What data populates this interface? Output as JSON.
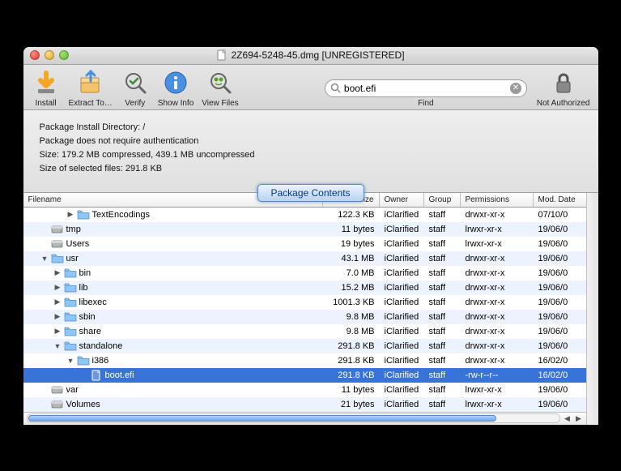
{
  "window": {
    "title": "2Z694-5248-45.dmg [UNREGISTERED]"
  },
  "toolbar": {
    "install": "Install",
    "extract": "Extract To…",
    "verify": "Verify",
    "showinfo": "Show Info",
    "viewfiles": "View Files",
    "find": "Find",
    "notauth": "Not Authorized"
  },
  "search": {
    "value": "boot.efi"
  },
  "info": {
    "line1": "Package Install Directory: /",
    "line2": "Package does not require authentication",
    "line3": "Size: 179.2 MB compressed, 439.1 MB uncompressed",
    "line4": "Size of selected files: 291.8 KB",
    "tab": "Package Contents"
  },
  "columns": {
    "name": "Filename",
    "size": "Size",
    "owner": "Owner",
    "group": "Group",
    "perm": "Permissions",
    "date": "Mod. Date"
  },
  "rows": [
    {
      "indent": 3,
      "arrow": "right",
      "icon": "folder",
      "name": "TextEncodings",
      "size": "122.3 KB",
      "owner": "iClarified",
      "group": "staff",
      "perm": "drwxr-xr-x",
      "date": "07/10/0",
      "alt": false,
      "sel": false
    },
    {
      "indent": 1,
      "arrow": "",
      "icon": "drive",
      "name": "tmp",
      "size": "11 bytes",
      "owner": "iClarified",
      "group": "staff",
      "perm": "lrwxr-xr-x",
      "date": "19/06/0",
      "alt": true,
      "sel": false
    },
    {
      "indent": 1,
      "arrow": "",
      "icon": "drive",
      "name": "Users",
      "size": "19 bytes",
      "owner": "iClarified",
      "group": "staff",
      "perm": "lrwxr-xr-x",
      "date": "19/06/0",
      "alt": false,
      "sel": false
    },
    {
      "indent": 1,
      "arrow": "down",
      "icon": "folder",
      "name": "usr",
      "size": "43.1 MB",
      "owner": "iClarified",
      "group": "staff",
      "perm": "drwxr-xr-x",
      "date": "19/06/0",
      "alt": true,
      "sel": false
    },
    {
      "indent": 2,
      "arrow": "right",
      "icon": "folder",
      "name": "bin",
      "size": "7.0 MB",
      "owner": "iClarified",
      "group": "staff",
      "perm": "drwxr-xr-x",
      "date": "19/06/0",
      "alt": false,
      "sel": false
    },
    {
      "indent": 2,
      "arrow": "right",
      "icon": "folder",
      "name": "lib",
      "size": "15.2 MB",
      "owner": "iClarified",
      "group": "staff",
      "perm": "drwxr-xr-x",
      "date": "19/06/0",
      "alt": true,
      "sel": false
    },
    {
      "indent": 2,
      "arrow": "right",
      "icon": "folder",
      "name": "libexec",
      "size": "1001.3 KB",
      "owner": "iClarified",
      "group": "staff",
      "perm": "drwxr-xr-x",
      "date": "19/06/0",
      "alt": false,
      "sel": false
    },
    {
      "indent": 2,
      "arrow": "right",
      "icon": "folder",
      "name": "sbin",
      "size": "9.8 MB",
      "owner": "iClarified",
      "group": "staff",
      "perm": "drwxr-xr-x",
      "date": "19/06/0",
      "alt": true,
      "sel": false
    },
    {
      "indent": 2,
      "arrow": "right",
      "icon": "folder",
      "name": "share",
      "size": "9.8 MB",
      "owner": "iClarified",
      "group": "staff",
      "perm": "drwxr-xr-x",
      "date": "19/06/0",
      "alt": false,
      "sel": false
    },
    {
      "indent": 2,
      "arrow": "down",
      "icon": "folder",
      "name": "standalone",
      "size": "291.8 KB",
      "owner": "iClarified",
      "group": "staff",
      "perm": "drwxr-xr-x",
      "date": "19/06/0",
      "alt": true,
      "sel": false
    },
    {
      "indent": 3,
      "arrow": "down",
      "icon": "folder",
      "name": "i386",
      "size": "291.8 KB",
      "owner": "iClarified",
      "group": "staff",
      "perm": "drwxr-xr-x",
      "date": "16/02/0",
      "alt": false,
      "sel": false
    },
    {
      "indent": 4,
      "arrow": "",
      "icon": "file",
      "name": "boot.efi",
      "size": "291.8 KB",
      "owner": "iClarified",
      "group": "staff",
      "perm": "-rw-r--r--",
      "date": "16/02/0",
      "alt": true,
      "sel": true
    },
    {
      "indent": 1,
      "arrow": "",
      "icon": "drive",
      "name": "var",
      "size": "11 bytes",
      "owner": "iClarified",
      "group": "staff",
      "perm": "lrwxr-xr-x",
      "date": "19/06/0",
      "alt": false,
      "sel": false
    },
    {
      "indent": 1,
      "arrow": "",
      "icon": "drive",
      "name": "Volumes",
      "size": "21 bytes",
      "owner": "iClarified",
      "group": "staff",
      "perm": "lrwxr-xr-x",
      "date": "19/06/0",
      "alt": true,
      "sel": false
    }
  ]
}
